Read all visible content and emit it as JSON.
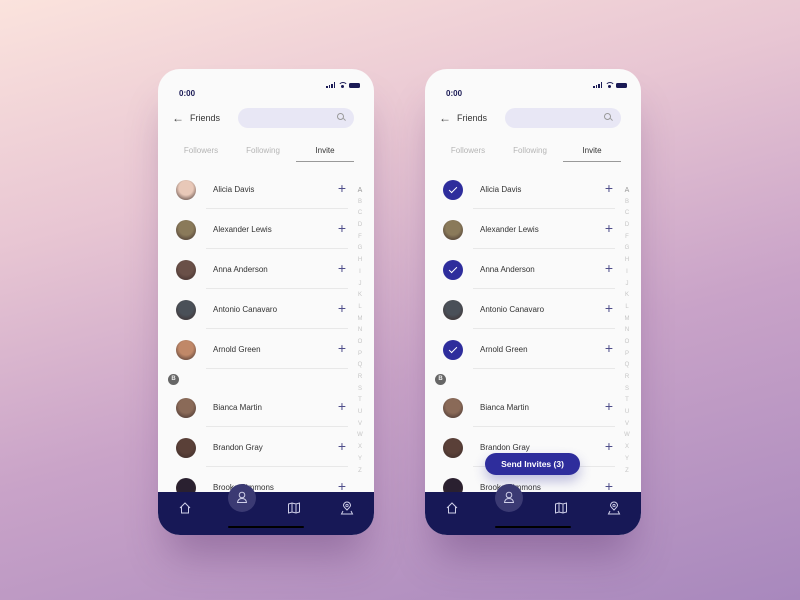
{
  "colors": {
    "accent": "#2e2d9c",
    "nav_bg": "#171856",
    "search_bg": "#e8e7f5"
  },
  "phones": [
    {
      "status": {
        "time": "0:00"
      },
      "header": {
        "back_icon": "arrow-left-icon",
        "title": "Friends",
        "search_placeholder": ""
      },
      "tabs": [
        {
          "label": "Followers",
          "active": false
        },
        {
          "label": "Following",
          "active": false
        },
        {
          "label": "Invite",
          "active": true
        }
      ],
      "contacts": [
        {
          "name": "Alicia Davis",
          "selected": false,
          "avatar_color": "#e8c8b8"
        },
        {
          "name": "Alexander Lewis",
          "selected": false,
          "avatar_color": "#8a7a5a"
        },
        {
          "name": "Anna Anderson",
          "selected": false,
          "avatar_color": "#6a5048"
        },
        {
          "name": "Antonio Canavaro",
          "selected": false,
          "avatar_color": "#4a5058"
        },
        {
          "name": "Arnold Green",
          "selected": false,
          "avatar_color": "#c08868"
        },
        {
          "name": "Bianca Martin",
          "selected": false,
          "avatar_color": "#8a6a58"
        },
        {
          "name": "Brandon Gray",
          "selected": false,
          "avatar_color": "#5a4038"
        },
        {
          "name": "Brooke Simmons",
          "selected": false,
          "avatar_color": "#2a2030"
        }
      ],
      "section_b": "B",
      "send_button": null
    },
    {
      "status": {
        "time": "0:00"
      },
      "header": {
        "back_icon": "arrow-left-icon",
        "title": "Friends",
        "search_placeholder": ""
      },
      "tabs": [
        {
          "label": "Followers",
          "active": false
        },
        {
          "label": "Following",
          "active": false
        },
        {
          "label": "Invite",
          "active": true
        }
      ],
      "contacts": [
        {
          "name": "Alicia Davis",
          "selected": true,
          "avatar_color": "#e8c8b8"
        },
        {
          "name": "Alexander Lewis",
          "selected": false,
          "avatar_color": "#8a7a5a"
        },
        {
          "name": "Anna Anderson",
          "selected": true,
          "avatar_color": "#6a5048"
        },
        {
          "name": "Antonio Canavaro",
          "selected": false,
          "avatar_color": "#4a5058"
        },
        {
          "name": "Arnold Green",
          "selected": true,
          "avatar_color": "#c08868"
        },
        {
          "name": "Bianca Martin",
          "selected": false,
          "avatar_color": "#8a6a58"
        },
        {
          "name": "Brandon Gray",
          "selected": false,
          "avatar_color": "#5a4038"
        },
        {
          "name": "Brooke Simmons",
          "selected": false,
          "avatar_color": "#2a2030"
        }
      ],
      "section_b": "B",
      "send_button": "Send Invites (3)"
    }
  ],
  "alphabet": [
    "A",
    "B",
    "C",
    "D",
    "F",
    "G",
    "H",
    "I",
    "J",
    "K",
    "L",
    "M",
    "N",
    "O",
    "P",
    "Q",
    "R",
    "S",
    "T",
    "U",
    "V",
    "W",
    "X",
    "Y",
    "Z"
  ],
  "nav": [
    {
      "icon": "home-icon",
      "active": false
    },
    {
      "icon": "user-icon",
      "active": true
    },
    {
      "icon": "map-icon",
      "active": false
    },
    {
      "icon": "location-pin-icon",
      "active": false
    }
  ]
}
